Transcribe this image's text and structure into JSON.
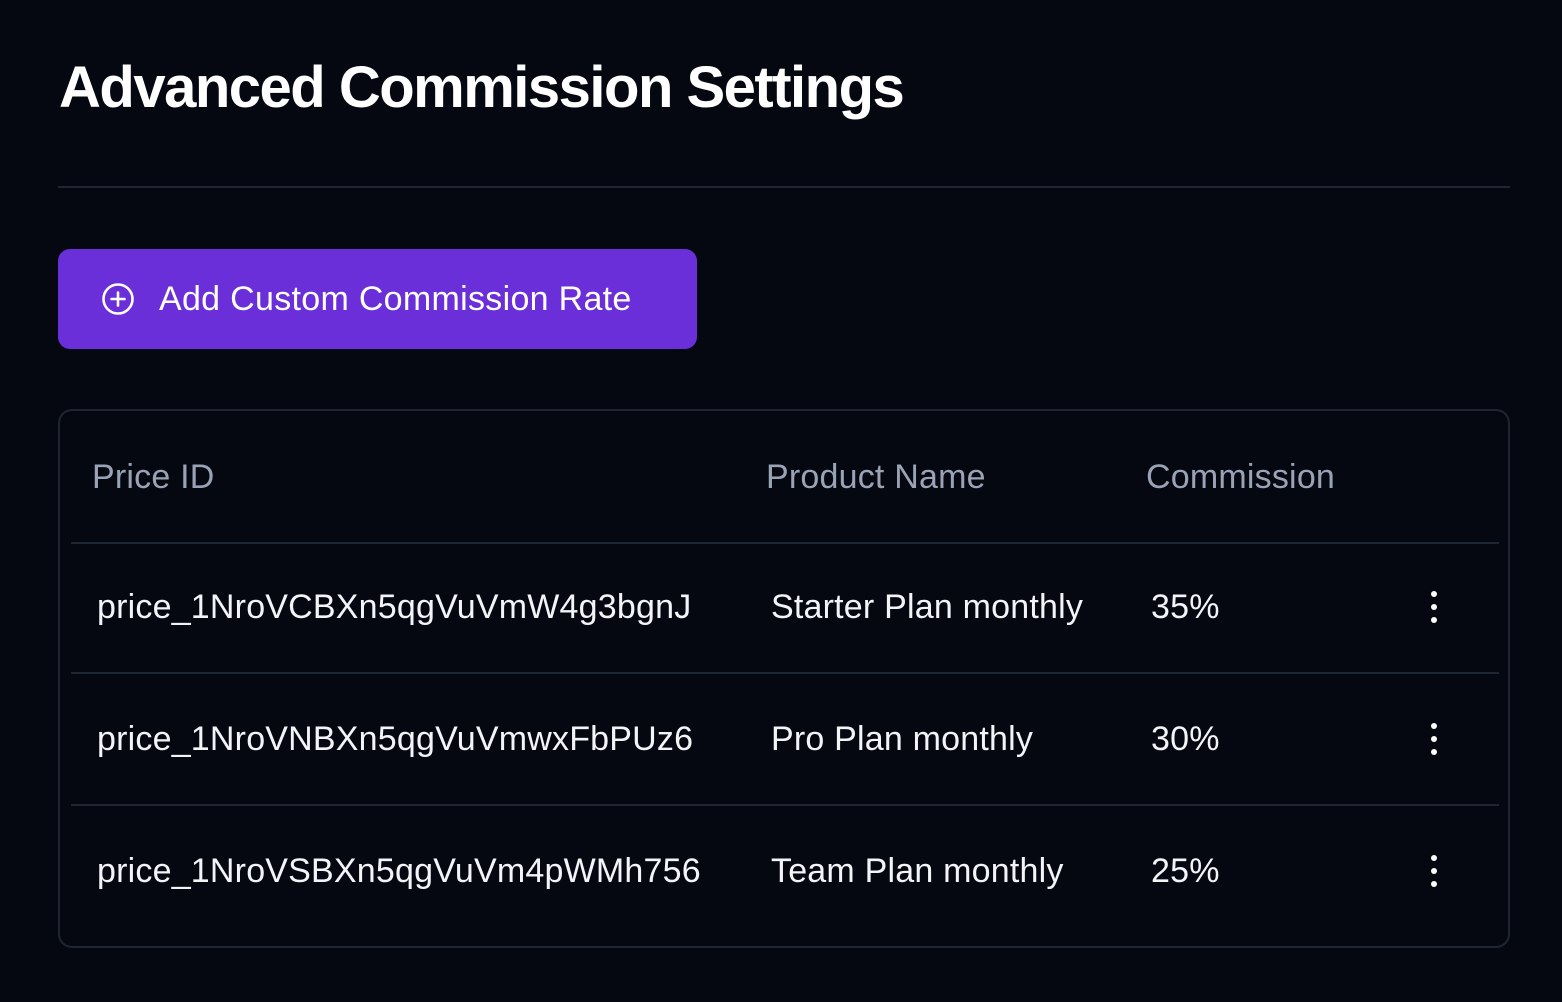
{
  "page": {
    "title": "Advanced Commission Settings"
  },
  "actions": {
    "add_button_label": "Add Custom Commission Rate",
    "add_button_icon": "plus-circle-icon"
  },
  "table": {
    "columns": [
      "Price ID",
      "Product Name",
      "Commission"
    ],
    "rows": [
      {
        "price_id": "price_1NroVCBXn5qgVuVmW4g3bgnJ",
        "product_name": "Starter Plan monthly",
        "commission": "35%"
      },
      {
        "price_id": "price_1NroVNBXn5qgVuVmwxFbPUz6",
        "product_name": "Pro Plan monthly",
        "commission": "30%"
      },
      {
        "price_id": "price_1NroVSBXn5qgVuVm4pWMh756",
        "product_name": "Team Plan monthly",
        "commission": "25%"
      }
    ],
    "row_menu_icon": "more-vertical-icon"
  },
  "colors": {
    "background": "#050811",
    "accent": "#6b2fd9",
    "border": "#1e2533",
    "header_text": "#9aa3b5",
    "text": "#f2f4f8"
  }
}
